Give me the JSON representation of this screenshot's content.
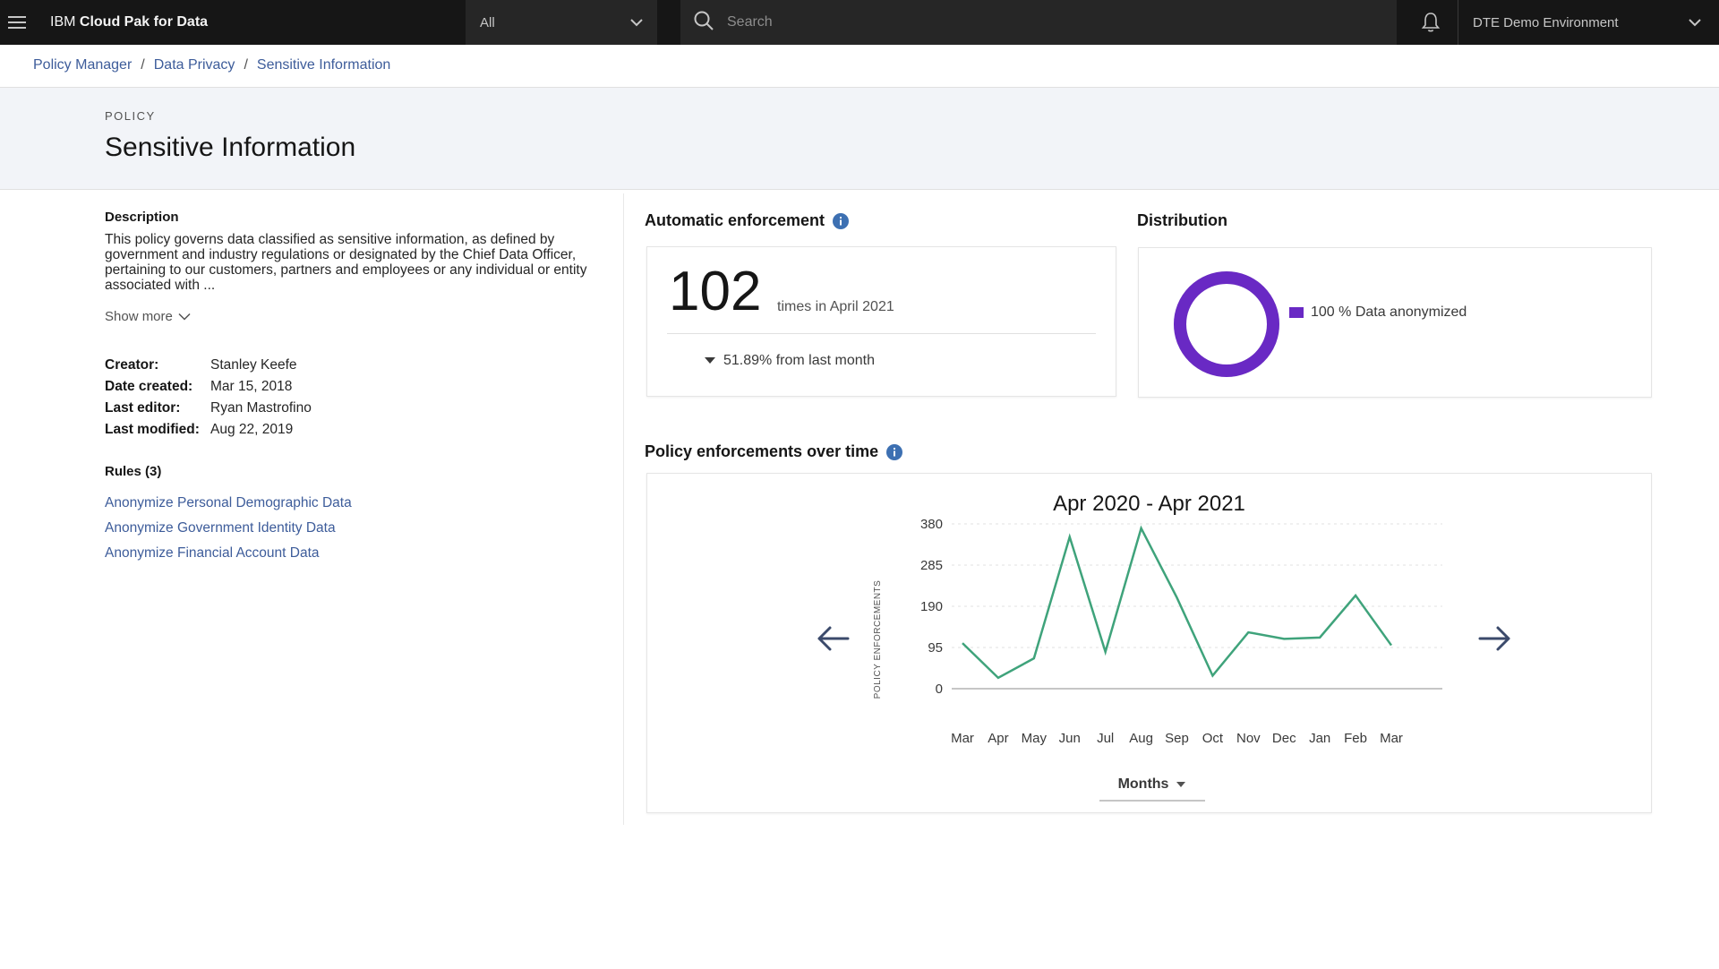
{
  "topbar": {
    "brand_prefix": "IBM",
    "brand_name": "Cloud Pak for Data",
    "scope_value": "All",
    "search_placeholder": "Search",
    "environment": "DTE Demo Environment"
  },
  "breadcrumb": [
    "Policy Manager",
    "Data Privacy",
    "Sensitive Information"
  ],
  "header": {
    "label": "POLICY",
    "title": "Sensitive Information"
  },
  "details": {
    "description_heading": "Description",
    "description": "This policy governs data classified as sensitive information, as defined by government and industry regulations or designated by the Chief Data Officer, pertaining to our customers, partners and employees or any individual or entity associated with ...",
    "show_more": "Show more",
    "meta": [
      {
        "key": "Creator:",
        "value": "Stanley Keefe"
      },
      {
        "key": "Date created:",
        "value": "Mar 15, 2018"
      },
      {
        "key": "Last editor:",
        "value": "Ryan Mastrofino"
      },
      {
        "key": "Last modified:",
        "value": "Aug 22, 2019"
      }
    ],
    "rules_heading": "Rules (3)",
    "rules": [
      "Anonymize Personal Demographic Data",
      "Anonymize Government Identity Data",
      "Anonymize Financial Account Data"
    ]
  },
  "enforcement": {
    "title": "Automatic enforcement",
    "count": "102",
    "count_suffix": "times in April 2021",
    "trend": "51.89% from last month"
  },
  "distribution": {
    "title": "Distribution",
    "legend": "100 % Data anonymized",
    "percent": 100,
    "color": "#6929c4"
  },
  "over_time": {
    "title": "Policy enforcements over time",
    "months_label": "Months"
  },
  "chart_data": {
    "type": "line",
    "title": "Apr 2020 - Apr 2021",
    "xlabel": "",
    "ylabel": "POLICY ENFORCEMENTS",
    "categories": [
      "Mar",
      "Apr",
      "May",
      "Jun",
      "Jul",
      "Aug",
      "Sep",
      "Oct",
      "Nov",
      "Dec",
      "Jan",
      "Feb",
      "Mar"
    ],
    "values": [
      105,
      25,
      70,
      350,
      85,
      370,
      210,
      30,
      130,
      115,
      118,
      215,
      100
    ],
    "yticks": [
      0,
      95,
      190,
      285,
      380
    ],
    "ylim": [
      0,
      380
    ],
    "grid": true,
    "color": "#3fa37b"
  }
}
